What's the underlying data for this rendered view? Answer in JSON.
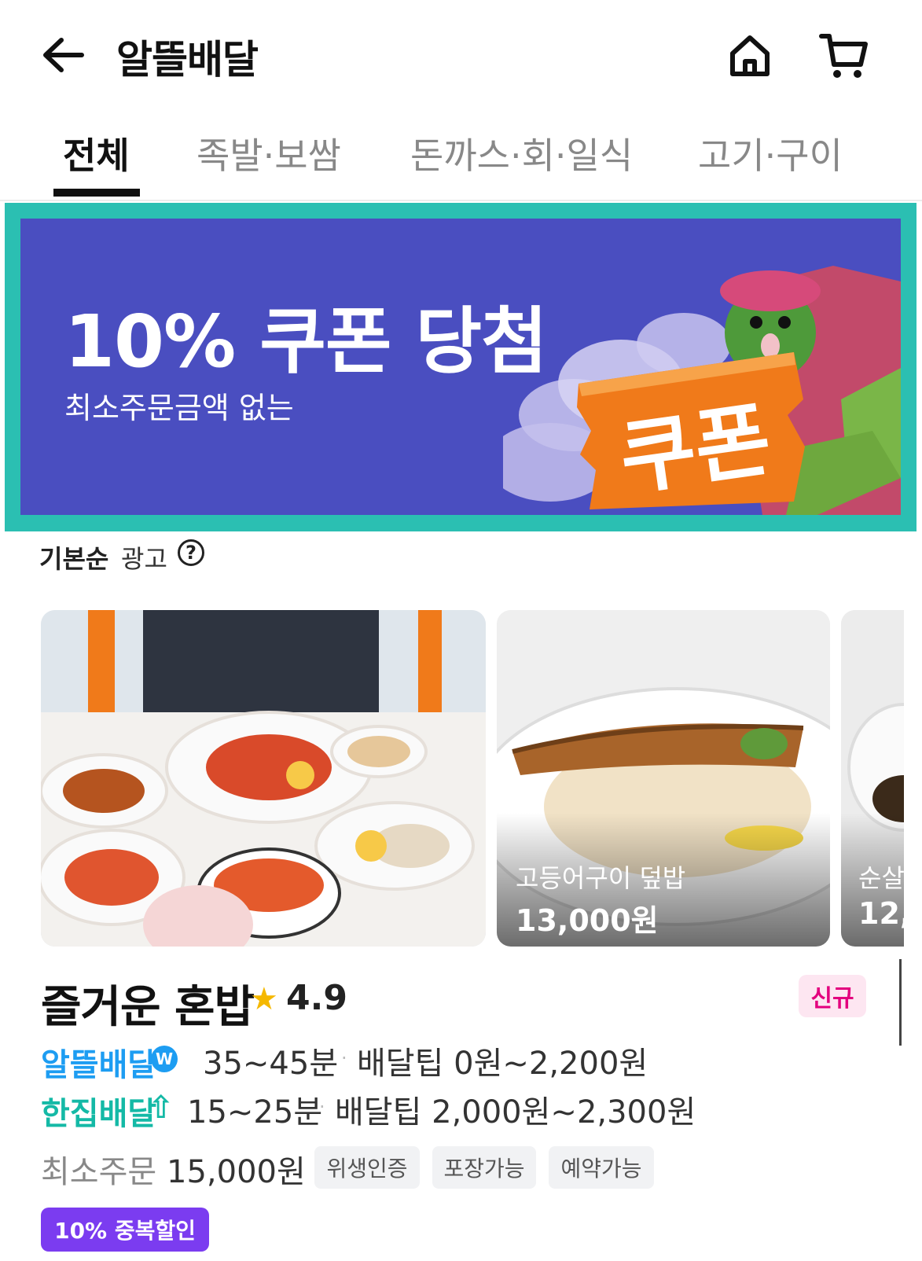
{
  "header": {
    "title": "알뜰배달",
    "back_icon": "arrow-left-icon",
    "home_icon": "home-icon",
    "cart_icon": "cart-icon"
  },
  "tabs": [
    {
      "label": "전체",
      "active": true
    },
    {
      "label": "족발·보쌈",
      "active": false
    },
    {
      "label": "돈까스·회·일식",
      "active": false
    },
    {
      "label": "고기·구이",
      "active": false
    }
  ],
  "banner": {
    "title": "10% 쿠폰 당첨",
    "subtitle": "최소주문금액 없는",
    "sign_text": "쿠폰",
    "background": "#4a4ec0",
    "frame_color": "#2bbfb2"
  },
  "sort": {
    "label": "기본순",
    "ad_label": "광고",
    "help": "?"
  },
  "menu_cards": [
    {
      "name": "",
      "price": ""
    },
    {
      "name": "고등어구이 덮밥",
      "price": "13,000원"
    },
    {
      "name": "순살",
      "price": "12,"
    }
  ],
  "store": {
    "name": "즐거운 혼밥",
    "rating": "4.9",
    "new_badge": "신규",
    "services": [
      {
        "name": "알뜰배달",
        "icon_text": "W",
        "time": "35~45분",
        "tip": "배달팁 0원~2,200원",
        "color": "#1d9df2"
      },
      {
        "name": "한집배달",
        "icon_text": "⇧",
        "time": "15~25분",
        "tip": "배달팁 2,000원~2,300원",
        "color": "#14b9a6"
      }
    ],
    "separator": "·",
    "min_order_label": "최소주문",
    "min_order_value": "15,000원",
    "chips": [
      "위생인증",
      "포장가능",
      "예약가능"
    ],
    "promo": "10% 중복할인"
  }
}
